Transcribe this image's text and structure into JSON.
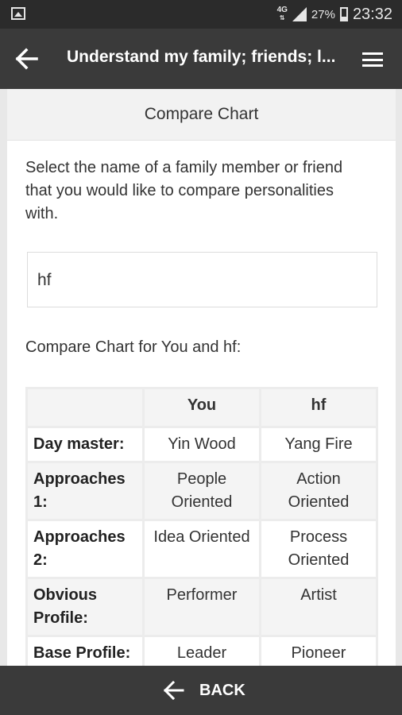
{
  "status_bar": {
    "network": "4G",
    "battery_percent": "27%",
    "battery_level": 0.27,
    "time": "23:32",
    "icons": [
      "gallery-icon",
      "signal-icon",
      "battery-icon"
    ]
  },
  "app_bar": {
    "title": "Understand my family; friends; l...",
    "icons": [
      "back-arrow-icon",
      "menu-icon"
    ]
  },
  "card": {
    "header": "Compare Chart",
    "instruction": "Select the name of a family member or friend that you would like to compare personalities with.",
    "selected_name": "hf",
    "compare_title": "Compare Chart for You and hf:"
  },
  "table": {
    "columns": [
      "",
      "You",
      "hf"
    ],
    "rows": [
      {
        "label": "Day master:",
        "you": "Yin Wood",
        "hf": "Yang Fire"
      },
      {
        "label": "Approaches 1:",
        "you": "People Oriented",
        "hf": "Action Oriented"
      },
      {
        "label": "Approaches 2:",
        "you": "Idea Oriented",
        "hf": "Process Oriented"
      },
      {
        "label": "Obvious Profile:",
        "you": "Performer",
        "hf": "Artist"
      },
      {
        "label": "Base Profile:",
        "you": "Leader",
        "hf": "Pioneer"
      }
    ]
  },
  "bottom_bar": {
    "back_label": "BACK"
  }
}
